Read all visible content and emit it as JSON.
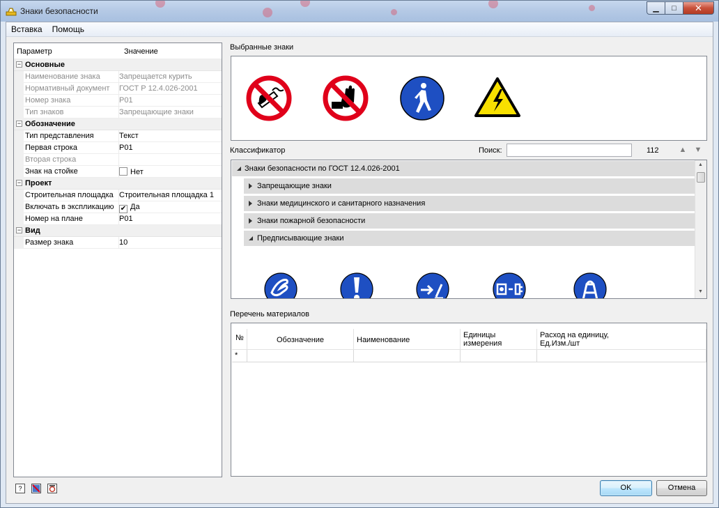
{
  "window": {
    "title": "Знаки безопасности"
  },
  "menu": [
    "Вставка",
    "Помощь"
  ],
  "propgrid": {
    "col_param": "Параметр",
    "col_value": "Значение",
    "categories": [
      {
        "name": "Основные",
        "toggle": "−",
        "rows": [
          {
            "label": "Наименование знака",
            "value": "Запрещается курить",
            "dim": true
          },
          {
            "label": "Нормативный документ",
            "value": "ГОСТ Р 12.4.026-2001",
            "dim": true
          },
          {
            "label": "Номер знака",
            "value": "P01",
            "dim": true
          },
          {
            "label": "Тип знаков",
            "value": "Запрещающие знаки",
            "dim": true
          }
        ]
      },
      {
        "name": "Обозначение",
        "toggle": "−",
        "rows": [
          {
            "label": "Тип представления",
            "value": "Текст"
          },
          {
            "label": "Первая строка",
            "value": "P01"
          },
          {
            "label": "Вторая строка",
            "value": "",
            "dim_label": true
          },
          {
            "label": "Знак на стойке",
            "value": "Нет",
            "checkbox": false
          }
        ]
      },
      {
        "name": "Проект",
        "toggle": "−",
        "rows": [
          {
            "label": "Строительная площадка",
            "value": "Строительная площадка 1"
          },
          {
            "label": "Включать в экспликацию",
            "value": "Да",
            "checkbox": true
          },
          {
            "label": "Номер на плане",
            "value": "P01"
          }
        ]
      },
      {
        "name": "Вид",
        "toggle": "−",
        "rows": [
          {
            "label": "Размер знака",
            "value": "10"
          }
        ]
      }
    ]
  },
  "selected": {
    "label": "Выбранные знаки",
    "signs": [
      "no-smoking-sign-icon",
      "no-touch-sign-icon",
      "pedestrian-sign-icon",
      "high-voltage-sign-icon"
    ]
  },
  "classifier": {
    "label": "Классификатор",
    "search_label": "Поиск:",
    "search_value": "",
    "count": "112",
    "root": "Знаки безопасности по ГОСТ 12.4.026-2001",
    "groups": [
      {
        "label": "Запрещающие знаки",
        "open": false
      },
      {
        "label": "Знаки медицинского и санитарного назначения",
        "open": false
      },
      {
        "label": "Знаки пожарной безопасности",
        "open": false
      },
      {
        "label": "Предписывающие знаки",
        "open": true
      }
    ],
    "signs": [
      "protective-gloves-sign-icon",
      "attention-sign-icon",
      "switch-off-sign-icon",
      "unplug-sign-icon",
      "harness-sign-icon"
    ]
  },
  "materials": {
    "label": "Перечень материалов",
    "columns": {
      "num": "№",
      "designation": "Обозначение",
      "name": "Наименование",
      "units_1": "Единицы",
      "units_2": "измерения",
      "rate_1": "Расход на единицу,",
      "rate_2": "Ед.Изм./шт"
    },
    "new_row_marker": "*"
  },
  "buttons": {
    "ok": "OK",
    "cancel": "Отмена"
  },
  "colors": {
    "prohibit_red": "#e0001a",
    "mandatory_blue": "#1e4fc2",
    "warning_yellow": "#f8e000",
    "tree_row": "#dcdcdc"
  }
}
